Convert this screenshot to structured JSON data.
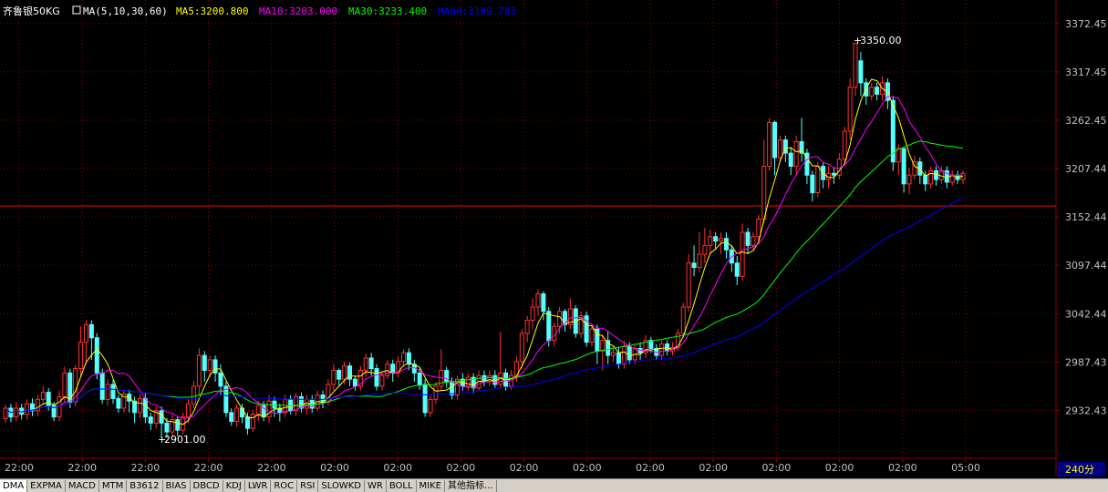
{
  "header": {
    "symbol": "齐鲁银50KG",
    "ma_label": "MA(5,10,30,60)",
    "ma5": "MA5:3200.800",
    "ma10": "MA10:3203.000",
    "ma30": "MA30:3233.400",
    "ma60": "MA60:3189.783"
  },
  "annotations": {
    "high_label": "3350.00",
    "low_label": "2901.00",
    "period_label": "240分"
  },
  "tabs": [
    "DMA",
    "EXPMA",
    "MACD",
    "MTM",
    "B3612",
    "BIAS",
    "DBCD",
    "KDJ",
    "LWR",
    "ROC",
    "RSI",
    "SLOWKD",
    "WR",
    "BOLL",
    "MIKE",
    "其他指标..."
  ],
  "colors": {
    "up": "#ff3232",
    "down": "#54ffff",
    "ma5": "#ffff00",
    "ma10": "#ff00ff",
    "ma30": "#00ff00",
    "ma60": "#0000ff",
    "grid": "#8b0000",
    "axis_text": "#c0c0c0",
    "ref_line": "#ff0000",
    "background": "#000000"
  },
  "chart_data": {
    "type": "candlestick",
    "title": "齐鲁银50KG",
    "y_ticks": [
      "3372.45",
      "3317.45",
      "3262.45",
      "3207.44",
      "3152.44",
      "3097.44",
      "3042.44",
      "2987.43",
      "2932.43"
    ],
    "x_ticks": [
      "22:00",
      "22:00",
      "22:00",
      "22:00",
      "22:00",
      "02:00",
      "02:00",
      "02:00",
      "02:00",
      "02:00",
      "02:00",
      "02:00",
      "02:00",
      "02:00",
      "02:00",
      "05:00"
    ],
    "ylim": [
      2878,
      3395
    ],
    "reference_line": 3165,
    "grid": true,
    "high": 3350.0,
    "low": 2901.0,
    "candles": [
      [
        2923,
        2935,
        2918,
        2939
      ],
      [
        2935,
        2925,
        2919,
        2940
      ],
      [
        2925,
        2935,
        2920,
        2942
      ],
      [
        2935,
        2928,
        2922,
        2940
      ],
      [
        2928,
        2940,
        2922,
        2945
      ],
      [
        2940,
        2932,
        2926,
        2946
      ],
      [
        2932,
        2945,
        2926,
        2950
      ],
      [
        2945,
        2953,
        2940,
        2960
      ],
      [
        2953,
        2938,
        2932,
        2958
      ],
      [
        2938,
        2925,
        2920,
        2942
      ],
      [
        2925,
        2948,
        2920,
        2955
      ],
      [
        2948,
        2975,
        2942,
        2982
      ],
      [
        2975,
        2942,
        2935,
        2980
      ],
      [
        2942,
        2980,
        2937,
        2984
      ],
      [
        2980,
        3010,
        2970,
        3028
      ],
      [
        3010,
        3030,
        2985,
        3035
      ],
      [
        3030,
        3015,
        2990,
        3035
      ],
      [
        3015,
        2975,
        2968,
        3020
      ],
      [
        2975,
        2945,
        2940,
        2980
      ],
      [
        2945,
        2962,
        2938,
        2968
      ],
      [
        2962,
        2946,
        2940,
        2967
      ],
      [
        2946,
        2935,
        2930,
        2950
      ],
      [
        2935,
        2951,
        2930,
        2956
      ],
      [
        2951,
        2943,
        2930,
        2956
      ],
      [
        2943,
        2930,
        2918,
        2948
      ],
      [
        2930,
        2946,
        2924,
        2951
      ],
      [
        2946,
        2925,
        2918,
        2952
      ],
      [
        2925,
        2918,
        2910,
        2930
      ],
      [
        2918,
        2932,
        2912,
        2937
      ],
      [
        2932,
        2918,
        2901,
        2937
      ],
      [
        2918,
        2908,
        2901,
        2924
      ],
      [
        2908,
        2922,
        2902,
        2928
      ],
      [
        2922,
        2910,
        2903,
        2926
      ],
      [
        2910,
        2925,
        2905,
        2930
      ],
      [
        2925,
        2940,
        2918,
        2945
      ],
      [
        2940,
        2960,
        2935,
        2966
      ],
      [
        2960,
        2995,
        2950,
        3003
      ],
      [
        2995,
        2978,
        2965,
        3000
      ],
      [
        2978,
        2990,
        2970,
        2995
      ],
      [
        2990,
        2975,
        2965,
        2995
      ],
      [
        2975,
        2960,
        2950,
        2985
      ],
      [
        2960,
        2930,
        2925,
        2965
      ],
      [
        2930,
        2920,
        2915,
        2935
      ],
      [
        2920,
        2935,
        2914,
        2940
      ],
      [
        2935,
        2925,
        2918,
        2940
      ],
      [
        2925,
        2912,
        2905,
        2930
      ],
      [
        2912,
        2928,
        2908,
        2933
      ],
      [
        2928,
        2938,
        2920,
        2943
      ],
      [
        2938,
        2925,
        2920,
        2943
      ],
      [
        2925,
        2943,
        2918,
        2950
      ],
      [
        2943,
        2935,
        2925,
        2948
      ],
      [
        2935,
        2930,
        2920,
        2940
      ],
      [
        2930,
        2945,
        2925,
        2950
      ],
      [
        2945,
        2932,
        2928,
        2950
      ],
      [
        2932,
        2948,
        2926,
        2952
      ],
      [
        2948,
        2935,
        2930,
        2953
      ],
      [
        2935,
        2945,
        2928,
        2950
      ],
      [
        2945,
        2935,
        2930,
        2950
      ],
      [
        2935,
        2950,
        2932,
        2955
      ],
      [
        2950,
        2942,
        2935,
        2955
      ],
      [
        2942,
        2962,
        2938,
        2968
      ],
      [
        2962,
        2978,
        2955,
        2985
      ],
      [
        2978,
        2968,
        2960,
        2980
      ],
      [
        2968,
        2983,
        2962,
        2988
      ],
      [
        2983,
        2968,
        2960,
        2987
      ],
      [
        2968,
        2960,
        2955,
        2972
      ],
      [
        2960,
        2978,
        2955,
        2983
      ],
      [
        2978,
        2992,
        2970,
        2997
      ],
      [
        2992,
        2980,
        2972,
        2998
      ],
      [
        2980,
        2960,
        2955,
        2985
      ],
      [
        2960,
        2972,
        2955,
        2977
      ],
      [
        2972,
        2985,
        2968,
        2990
      ],
      [
        2985,
        2975,
        2965,
        2990
      ],
      [
        2975,
        2988,
        2970,
        2994
      ],
      [
        2988,
        2998,
        2982,
        3002
      ],
      [
        2998,
        2985,
        2978,
        3003
      ],
      [
        2985,
        2975,
        2965,
        2990
      ],
      [
        2975,
        2962,
        2956,
        2980
      ],
      [
        2962,
        2930,
        2925,
        2968
      ],
      [
        2930,
        2945,
        2925,
        2950
      ],
      [
        2945,
        2960,
        2940,
        2965
      ],
      [
        2960,
        2978,
        2955,
        3002
      ],
      [
        2978,
        2965,
        2958,
        2982
      ],
      [
        2965,
        2950,
        2945,
        2970
      ],
      [
        2950,
        2968,
        2945,
        2972
      ],
      [
        2968,
        2960,
        2955,
        2975
      ],
      [
        2960,
        2970,
        2955,
        2975
      ],
      [
        2970,
        2958,
        2952,
        2975
      ],
      [
        2958,
        2972,
        2955,
        2978
      ],
      [
        2972,
        2965,
        2960,
        2978
      ],
      [
        2965,
        2972,
        2960,
        2978
      ],
      [
        2972,
        2962,
        2958,
        2978
      ],
      [
        2962,
        2975,
        2958,
        3022
      ],
      [
        2975,
        2960,
        2955,
        2980
      ],
      [
        2960,
        2972,
        2956,
        2978
      ],
      [
        2972,
        2988,
        2965,
        2994
      ],
      [
        2988,
        3020,
        2980,
        3025
      ],
      [
        3020,
        3035,
        3010,
        3040
      ],
      [
        3035,
        3050,
        3025,
        3060
      ],
      [
        3050,
        3065,
        3040,
        3070
      ],
      [
        3065,
        3045,
        3035,
        3068
      ],
      [
        3045,
        3012,
        3005,
        3050
      ],
      [
        3012,
        3028,
        3005,
        3033
      ],
      [
        3028,
        3045,
        3020,
        3050
      ],
      [
        3045,
        3030,
        3022,
        3048
      ],
      [
        3030,
        3048,
        3025,
        3060
      ],
      [
        3048,
        3020,
        3015,
        3052
      ],
      [
        3020,
        3040,
        3015,
        3045
      ],
      [
        3040,
        3010,
        3005,
        3045
      ],
      [
        3010,
        3025,
        3005,
        3030
      ],
      [
        3025,
        3000,
        2985,
        3030
      ],
      [
        3000,
        3012,
        2978,
        3018
      ],
      [
        3012,
        2995,
        2985,
        3022
      ],
      [
        2995,
        2998,
        2988,
        3005
      ],
      [
        2998,
        2985,
        2980,
        3005
      ],
      [
        2985,
        3005,
        2980,
        3012
      ],
      [
        3005,
        2990,
        2985,
        3010
      ],
      [
        2990,
        3003,
        2985,
        3008
      ],
      [
        3003,
        2998,
        2990,
        3010
      ],
      [
        2998,
        3012,
        2992,
        3018
      ],
      [
        3012,
        3003,
        2998,
        3016
      ],
      [
        3003,
        2995,
        2990,
        3008
      ],
      [
        2995,
        3008,
        2990,
        3012
      ],
      [
        3008,
        3000,
        2995,
        3012
      ],
      [
        3000,
        3004,
        2995,
        3010
      ],
      [
        3004,
        3020,
        3000,
        3025
      ],
      [
        3020,
        3050,
        3015,
        3055
      ],
      [
        3050,
        3100,
        3045,
        3110
      ],
      [
        3100,
        3095,
        3085,
        3120
      ],
      [
        3095,
        3110,
        3090,
        3135
      ],
      [
        3110,
        3120,
        3100,
        3140
      ],
      [
        3120,
        3130,
        3110,
        3138
      ],
      [
        3130,
        3125,
        3115,
        3135
      ],
      [
        3125,
        3128,
        3110,
        3135
      ],
      [
        3128,
        3115,
        3105,
        3135
      ],
      [
        3115,
        3100,
        3090,
        3120
      ],
      [
        3100,
        3085,
        3075,
        3108
      ],
      [
        3085,
        3135,
        3080,
        3145
      ],
      [
        3135,
        3120,
        3110,
        3140
      ],
      [
        3120,
        3130,
        3115,
        3135
      ],
      [
        3130,
        3150,
        3125,
        3155
      ],
      [
        3150,
        3210,
        3145,
        3240
      ],
      [
        3210,
        3260,
        3205,
        3265
      ],
      [
        3260,
        3220,
        3200,
        3262
      ],
      [
        3220,
        3240,
        3215,
        3245
      ],
      [
        3240,
        3225,
        3215,
        3245
      ],
      [
        3225,
        3210,
        3200,
        3232
      ],
      [
        3210,
        3238,
        3200,
        3245
      ],
      [
        3238,
        3225,
        3215,
        3265
      ],
      [
        3225,
        3200,
        3190,
        3230
      ],
      [
        3200,
        3180,
        3170,
        3205
      ],
      [
        3180,
        3210,
        3175,
        3215
      ],
      [
        3210,
        3195,
        3185,
        3215
      ],
      [
        3195,
        3202,
        3185,
        3210
      ],
      [
        3202,
        3200,
        3190,
        3208
      ],
      [
        3200,
        3218,
        3195,
        3225
      ],
      [
        3218,
        3250,
        3210,
        3255
      ],
      [
        3250,
        3300,
        3240,
        3310
      ],
      [
        3300,
        3350,
        3290,
        3350
      ],
      [
        3330,
        3305,
        3290,
        3340
      ],
      [
        3305,
        3290,
        3280,
        3310
      ],
      [
        3290,
        3300,
        3285,
        3305
      ],
      [
        3300,
        3292,
        3285,
        3305
      ],
      [
        3292,
        3305,
        3285,
        3312
      ],
      [
        3305,
        3285,
        3275,
        3310
      ],
      [
        3285,
        3215,
        3205,
        3290
      ],
      [
        3215,
        3230,
        3200,
        3235
      ],
      [
        3230,
        3190,
        3180,
        3232
      ],
      [
        3190,
        3200,
        3178,
        3208
      ],
      [
        3200,
        3215,
        3195,
        3222
      ],
      [
        3215,
        3200,
        3190,
        3220
      ],
      [
        3200,
        3190,
        3182,
        3205
      ],
      [
        3190,
        3205,
        3185,
        3210
      ],
      [
        3205,
        3195,
        3188,
        3210
      ],
      [
        3195,
        3205,
        3190,
        3210
      ],
      [
        3205,
        3192,
        3185,
        3210
      ],
      [
        3192,
        3200,
        3188,
        3205
      ],
      [
        3200,
        3195,
        3190,
        3205
      ],
      [
        3195,
        3202,
        3190,
        3205
      ]
    ],
    "series": [
      {
        "name": "MA5"
      },
      {
        "name": "MA10"
      },
      {
        "name": "MA30"
      },
      {
        "name": "MA60"
      }
    ]
  }
}
